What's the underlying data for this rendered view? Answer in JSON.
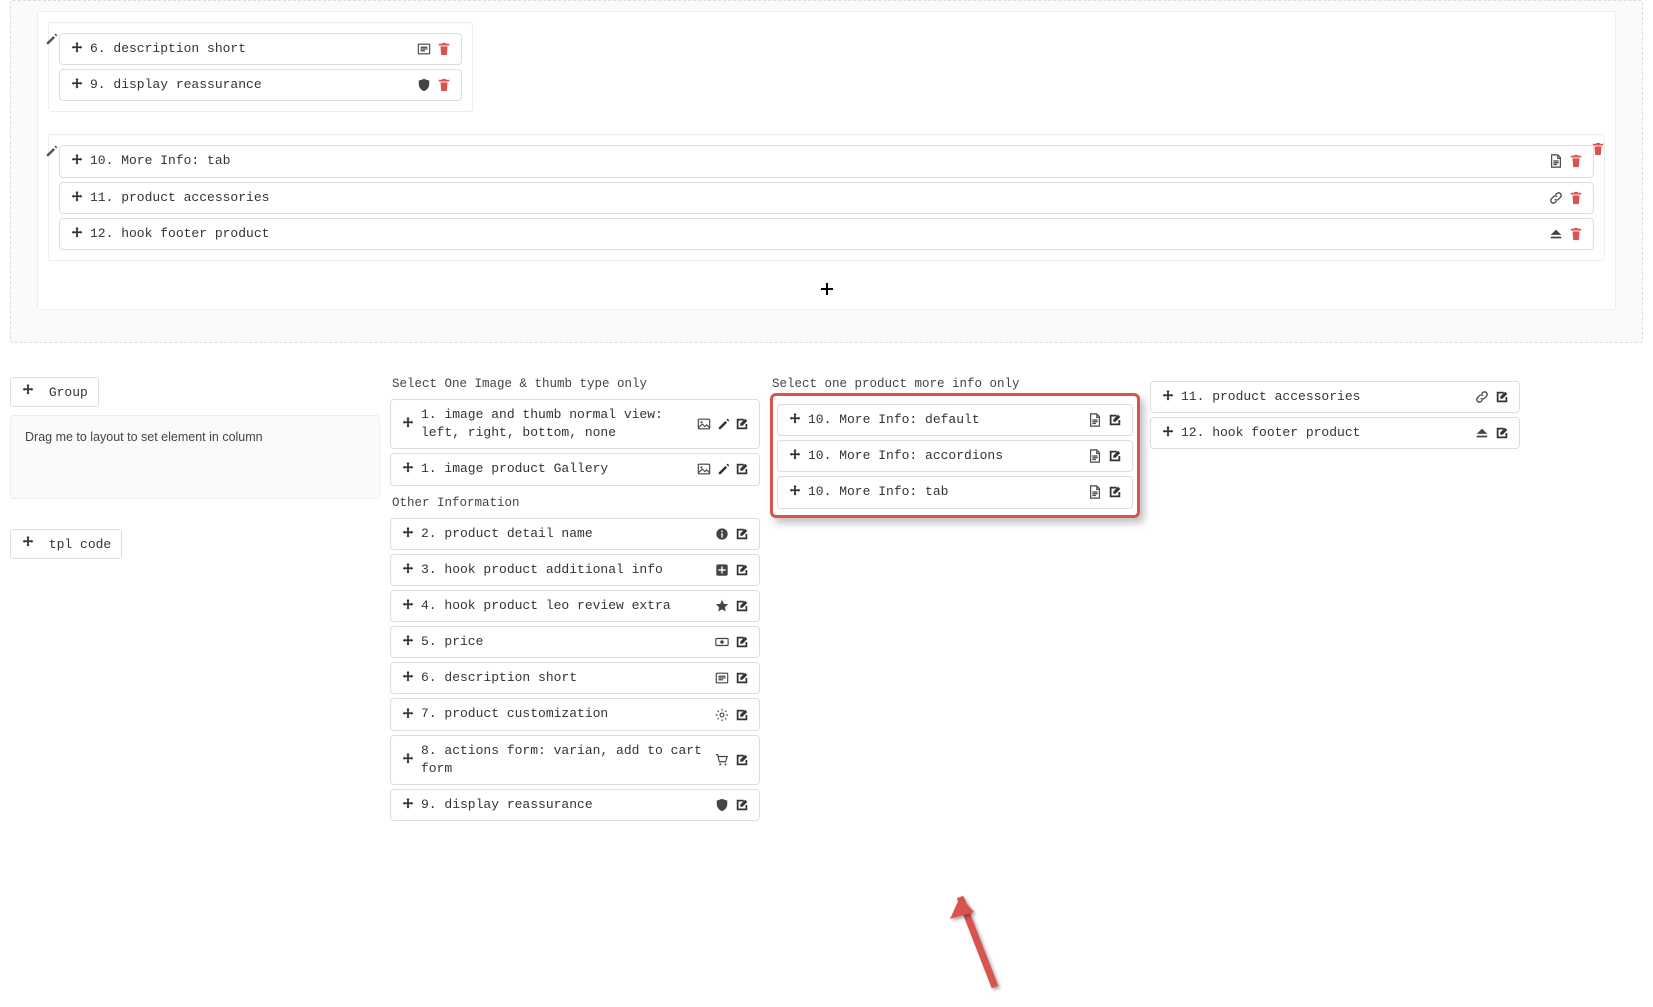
{
  "top": {
    "small_box": {
      "items": [
        {
          "label": "6. description short",
          "icon": "square-list-icon"
        },
        {
          "label": "9. display reassurance",
          "icon": "shield-icon"
        }
      ]
    },
    "full_box": {
      "items": [
        {
          "label": "10. More Info: tab",
          "icon": "file-icon"
        },
        {
          "label": "11. product accessories",
          "icon": "link-icon"
        },
        {
          "label": "12. hook footer product",
          "icon": "eject-icon"
        }
      ]
    }
  },
  "bottom": {
    "group_btn": "Group",
    "drag_hint": "Drag me to layout to set element in column",
    "tpl_btn": "tpl code",
    "image_section": {
      "title": "Select One Image & thumb type only",
      "items": [
        {
          "label": "1. image and thumb normal view: left, right, bottom, none",
          "icon": "image-icon",
          "has_pencil": true
        },
        {
          "label": "1. image product Gallery",
          "icon": "image-icon",
          "has_pencil": true
        }
      ]
    },
    "other_section": {
      "title": "Other Information",
      "items": [
        {
          "label": "2. product detail name",
          "icon": "info-icon"
        },
        {
          "label": "3. hook product additional info",
          "icon": "plus-square-icon"
        },
        {
          "label": "4. hook product leo review extra",
          "icon": "star-icon"
        },
        {
          "label": "5. price",
          "icon": "money-icon"
        },
        {
          "label": "6. description short",
          "icon": "square-list-icon"
        },
        {
          "label": "7. product customization",
          "icon": "gear-outline-icon"
        },
        {
          "label": "8. actions form: varian, add to cart form",
          "icon": "cart-icon"
        },
        {
          "label": "9. display reassurance",
          "icon": "shield-icon"
        }
      ]
    },
    "info_section": {
      "title": "Select one product more info only",
      "items": [
        {
          "label": "10. More Info: default",
          "icon": "file-icon"
        },
        {
          "label": "10. More Info: accordions",
          "icon": "file-icon"
        },
        {
          "label": "10. More Info: tab",
          "icon": "file-icon"
        }
      ]
    },
    "right_section": {
      "items": [
        {
          "label": "11. product accessories",
          "icon": "link-icon"
        },
        {
          "label": "12. hook footer product",
          "icon": "eject-icon"
        }
      ]
    }
  },
  "icons": {
    "move": "✥",
    "pencil": "✎",
    "edit": "✎",
    "trash": "🗑",
    "plus": "+"
  }
}
